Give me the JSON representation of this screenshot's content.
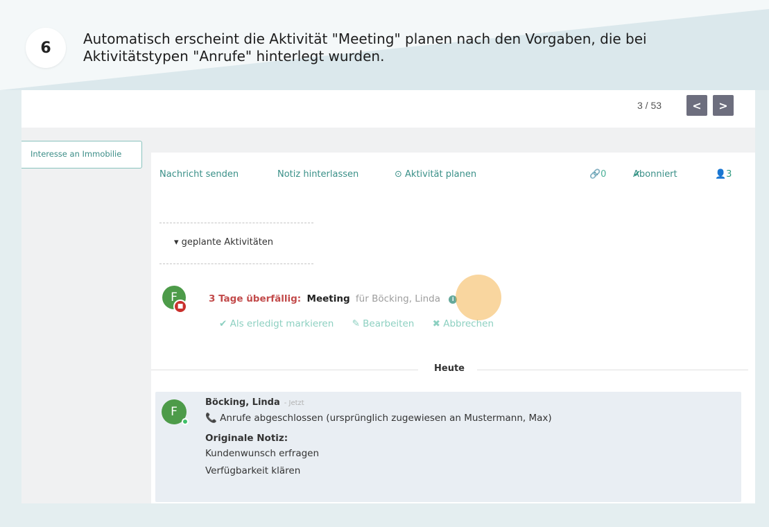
{
  "banner": {
    "step_number": "6",
    "text": "Automatisch erscheint die Aktivität \"Meeting\" planen nach den Vorgaben, die bei Aktivitätstypen \"Anrufe\" hinterlegt wurden."
  },
  "pager": {
    "text": "3 / 53",
    "prev_icon": "<",
    "next_icon": ">"
  },
  "tag": {
    "label": "Interesse an Immobilie"
  },
  "chatter": {
    "send_message": "Nachricht senden",
    "log_note": "Notiz hinterlassen",
    "schedule_activity": "⊙ Aktivität planen",
    "attachments_count": "🔗0",
    "subscribed_label": "Abonniert",
    "followers_count": "👤3"
  },
  "planned": {
    "toggle_label": "▾ geplante Aktivitäten",
    "activity": {
      "avatar_initial": "F",
      "status": "3 Tage überfällig:",
      "type": "Meeting",
      "assignee": "für Böcking, Linda",
      "info_icon": "i",
      "mark_done": "✔ Als erledigt markieren",
      "edit": "✎ Bearbeiten",
      "cancel": "✖ Abbrechen"
    }
  },
  "timeline": {
    "today_label": "Heute"
  },
  "message": {
    "avatar_initial": "F",
    "author": "Böcking, Linda",
    "time": "- Jetzt",
    "line1": "📞 Anrufe abgeschlossen (ursprünglich zugewiesen an Mustermann, Max)",
    "line2": "Originale Notiz:",
    "line3": "Kundenwunsch erfragen",
    "line4": "Verfügbarkeit klären"
  }
}
